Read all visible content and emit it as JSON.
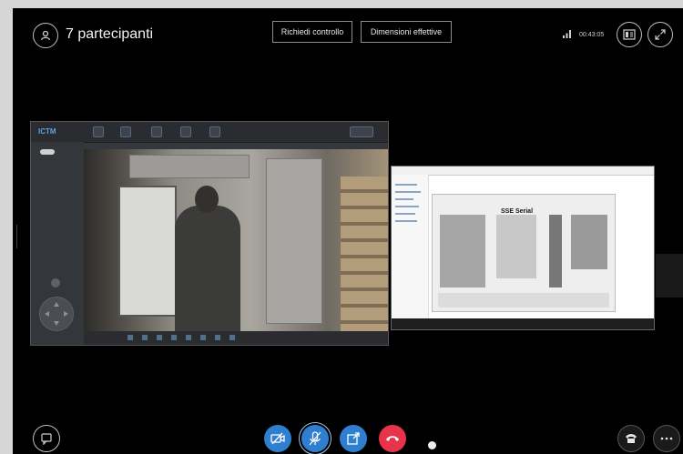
{
  "header": {
    "participants_label": "7 partecipanti",
    "buttons": {
      "control_tab": "Richiedi controllo",
      "actual_size": "Dimensioni effettive"
    },
    "status_text": "00:43:05"
  },
  "shared_screen": {
    "app_logo": "ICTM"
  },
  "remote_desktop": {
    "header_title": "SSE Serial"
  },
  "colors": {
    "background": "#000000",
    "call_button_blue": "#2f7fd0",
    "hangup_red": "#e8344a"
  },
  "icons": {
    "participants": "people-icon",
    "signal": "signal-icon",
    "present": "present-icon",
    "fullscreen": "expand-icon",
    "chat": "chat-icon",
    "video": "video-off-icon",
    "mic": "mic-icon",
    "share": "share-icon",
    "hangup": "hangup-icon",
    "dialpad": "phone-icon",
    "more": "more-icon"
  }
}
